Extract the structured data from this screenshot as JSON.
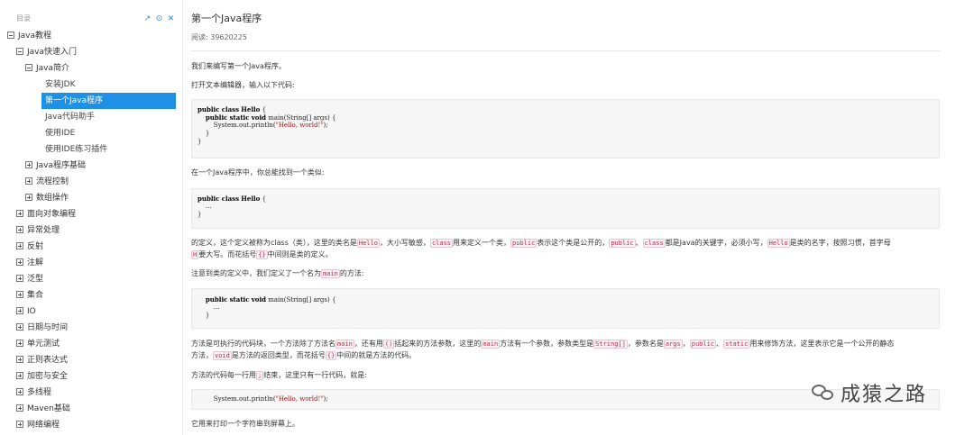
{
  "sidebar": {
    "title": "目录",
    "tools": [
      "↗",
      "⊙",
      "✕"
    ],
    "items": [
      {
        "label": "Java教程",
        "level": 0,
        "toggle": "open"
      },
      {
        "label": "Java快速入门",
        "level": 1,
        "toggle": "open"
      },
      {
        "label": "Java简介",
        "level": 2,
        "toggle": "open"
      },
      {
        "label": "安装JDK",
        "level": 3,
        "toggle": "none"
      },
      {
        "label": "第一个Java程序",
        "level": 3,
        "toggle": "none",
        "active": true
      },
      {
        "label": "Java代码助手",
        "level": 3,
        "toggle": "none"
      },
      {
        "label": "使用IDE",
        "level": 3,
        "toggle": "none"
      },
      {
        "label": "使用IDE练习插件",
        "level": 3,
        "toggle": "none"
      },
      {
        "label": "Java程序基础",
        "level": 2,
        "toggle": "closed"
      },
      {
        "label": "流程控制",
        "level": 2,
        "toggle": "closed"
      },
      {
        "label": "数组操作",
        "level": 2,
        "toggle": "closed"
      },
      {
        "label": "面向对象编程",
        "level": 1,
        "toggle": "closed"
      },
      {
        "label": "异常处理",
        "level": 1,
        "toggle": "closed"
      },
      {
        "label": "反射",
        "level": 1,
        "toggle": "closed"
      },
      {
        "label": "注解",
        "level": 1,
        "toggle": "closed"
      },
      {
        "label": "泛型",
        "level": 1,
        "toggle": "closed"
      },
      {
        "label": "集合",
        "level": 1,
        "toggle": "closed"
      },
      {
        "label": "IO",
        "level": 1,
        "toggle": "closed"
      },
      {
        "label": "日期与时间",
        "level": 1,
        "toggle": "closed"
      },
      {
        "label": "单元测试",
        "level": 1,
        "toggle": "closed"
      },
      {
        "label": "正则表达式",
        "level": 1,
        "toggle": "closed"
      },
      {
        "label": "加密与安全",
        "level": 1,
        "toggle": "closed"
      },
      {
        "label": "多线程",
        "level": 1,
        "toggle": "closed"
      },
      {
        "label": "Maven基础",
        "level": 1,
        "toggle": "closed"
      },
      {
        "label": "网络编程",
        "level": 1,
        "toggle": "closed"
      }
    ]
  },
  "article": {
    "title": "第一个Java程序",
    "read_count": "阅读: 39620225",
    "p1": "我们来编写第一个Java程序。",
    "p2": "打开文本编辑器，输入以下代码:",
    "code1": [
      "public class Hello {",
      "    public static void main(String[] args) {",
      "        System.out.println(\"Hello, world!\");",
      "    }",
      "}"
    ],
    "p3": "在一个Java程序中，你总能找到一个类似:",
    "code2": [
      "public class Hello {",
      "    ...",
      "}"
    ],
    "p4_parts": [
      "的定义，这个定义被称为class（类），这里的类名是",
      "Hello",
      "，大小写敏感，",
      "class",
      "用来定义一个类，",
      "public",
      "表示这个类是公开的，",
      "public",
      "、",
      "class",
      "都是Java的关键字，必须小写，",
      "Hello",
      "是类的名字，按照习惯，首字母"
    ],
    "p4b_parts": [
      "H",
      "要大写。而花括号",
      "{}",
      "中间则是类的定义。"
    ],
    "p5_parts": [
      "注意到类的定义中，我们定义了一个名为",
      "main",
      "的方法:"
    ],
    "code3": [
      "    public static void main(String[] args) {",
      "        ...",
      "    }"
    ],
    "p6_parts": [
      "方法是可执行的代码块，一个方法除了方法名",
      "main",
      "，还有用",
      "()",
      "括起来的方法参数，这里的",
      "main",
      "方法有一个参数，参数类型是",
      "String[]",
      "，参数名是",
      "args",
      "，",
      "public",
      "、",
      "static",
      "用来修饰方法，这里表示它是一个公开的静态"
    ],
    "p6b_parts": [
      "方法，",
      "void",
      "是方法的返回类型，而花括号",
      "{}",
      "中间的就是方法的代码。"
    ],
    "p7_parts": [
      "方法的代码每一行用",
      ";",
      "结束，这里只有一行代码，就是:"
    ],
    "code4": [
      "        System.out.println(\"Hello, world!\");"
    ],
    "p8": "它用来打印一个字符串到屏幕上。"
  },
  "watermark": {
    "text": "成猿之路"
  },
  "colors": {
    "accent": "#1e90e6",
    "code_inline": "#c7254e",
    "code_bg": "#f6f6f6"
  }
}
